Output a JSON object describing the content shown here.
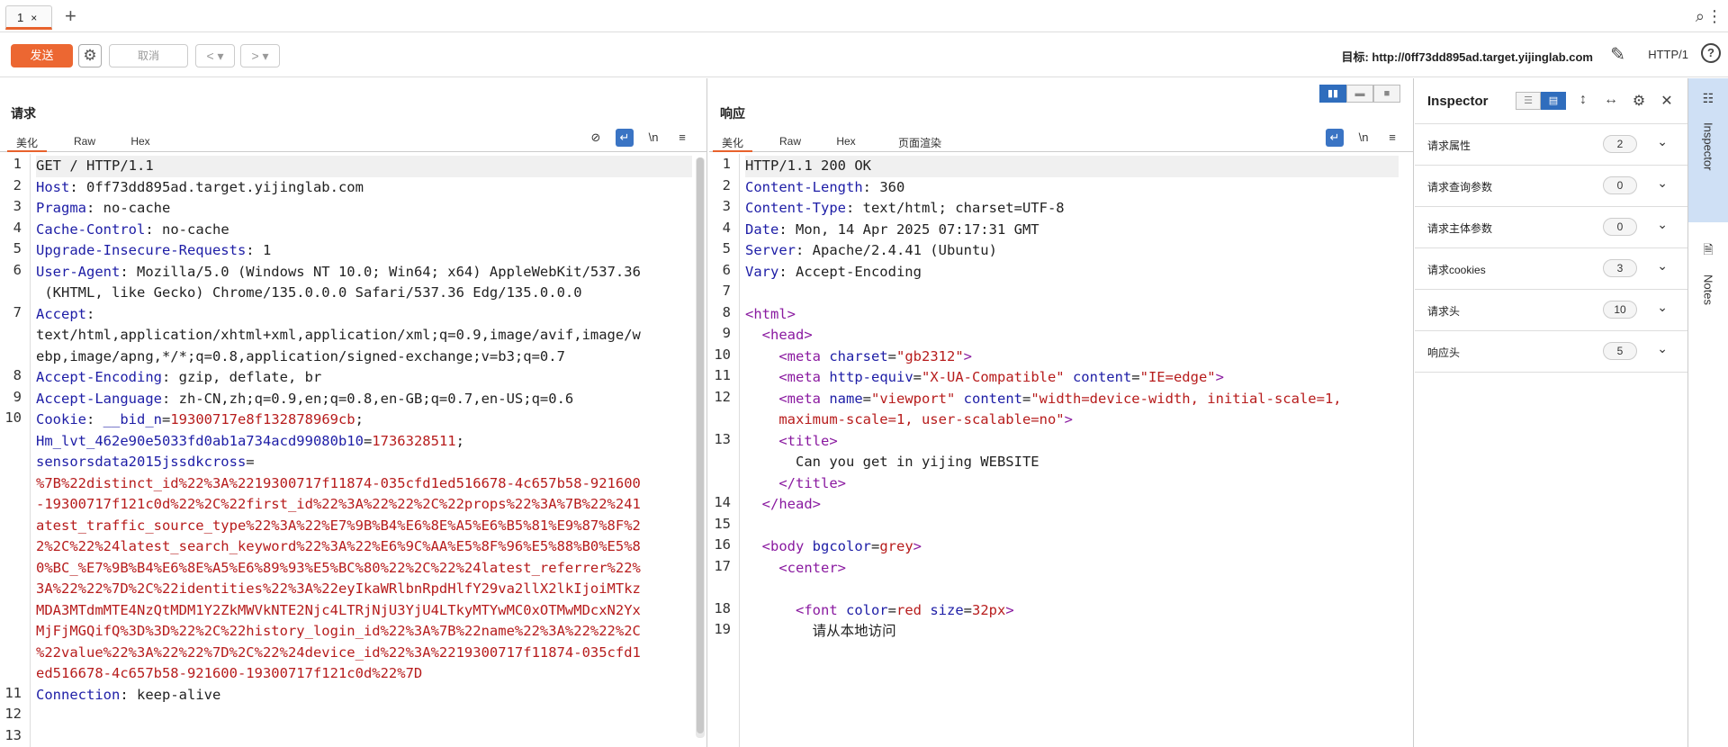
{
  "tabbar": {
    "tab_label": "1",
    "tab_close": "×",
    "add": "+"
  },
  "toolbar": {
    "send": "发送",
    "cancel": "取消",
    "back": "< ▾",
    "forward": "> ▾",
    "target": "目标: http://0ff73dd895ad.target.yijinglab.com",
    "protocol": "HTTP/1",
    "help": "?"
  },
  "request": {
    "title": "请求",
    "tabs": [
      "美化",
      "Raw",
      "Hex"
    ],
    "lines": [
      {
        "n": "1",
        "parts": [
          {
            "t": "GET / HTTP/1.1",
            "c": ""
          }
        ]
      },
      {
        "n": "2",
        "parts": [
          {
            "t": "Host",
            "c": "k"
          },
          {
            "t": ": 0ff73dd895ad.target.yijinglab.com",
            "c": ""
          }
        ]
      },
      {
        "n": "3",
        "parts": [
          {
            "t": "Pragma",
            "c": "k"
          },
          {
            "t": ": no-cache",
            "c": ""
          }
        ]
      },
      {
        "n": "4",
        "parts": [
          {
            "t": "Cache-Control",
            "c": "k"
          },
          {
            "t": ": no-cache",
            "c": ""
          }
        ]
      },
      {
        "n": "5",
        "parts": [
          {
            "t": "Upgrade-Insecure-Requests",
            "c": "k"
          },
          {
            "t": ": 1",
            "c": ""
          }
        ]
      },
      {
        "n": "6",
        "parts": [
          {
            "t": "User-Agent",
            "c": "k"
          },
          {
            "t": ": Mozilla/5.0 (Windows NT 10.0; Win64; x64) AppleWebKit/537.36",
            "c": ""
          }
        ]
      },
      {
        "n": "",
        "parts": [
          {
            "t": " (KHTML, like Gecko) Chrome/135.0.0.0 Safari/537.36 Edg/135.0.0.0",
            "c": ""
          }
        ]
      },
      {
        "n": "7",
        "parts": [
          {
            "t": "Accept",
            "c": "k"
          },
          {
            "t": ":",
            "c": ""
          }
        ]
      },
      {
        "n": "",
        "parts": [
          {
            "t": "text/html,application/xhtml+xml,application/xml;q=0.9,image/avif,image/w",
            "c": ""
          }
        ]
      },
      {
        "n": "",
        "parts": [
          {
            "t": "ebp,image/apng,*/*;q=0.8,application/signed-exchange;v=b3;q=0.7",
            "c": ""
          }
        ]
      },
      {
        "n": "8",
        "parts": [
          {
            "t": "Accept-Encoding",
            "c": "k"
          },
          {
            "t": ": gzip, deflate, br",
            "c": ""
          }
        ]
      },
      {
        "n": "9",
        "parts": [
          {
            "t": "Accept-Language",
            "c": "k"
          },
          {
            "t": ": zh-CN,zh;q=0.9,en;q=0.8,en-GB;q=0.7,en-US;q=0.6",
            "c": ""
          }
        ]
      },
      {
        "n": "10",
        "parts": [
          {
            "t": "Cookie",
            "c": "k"
          },
          {
            "t": ": ",
            "c": ""
          },
          {
            "t": "__bid_n",
            "c": "k"
          },
          {
            "t": "=",
            "c": ""
          },
          {
            "t": "19300717e8f132878969cb",
            "c": "v"
          },
          {
            "t": ";",
            "c": ""
          }
        ]
      },
      {
        "n": "",
        "parts": [
          {
            "t": "Hm_lvt_462e90e5033fd0ab1a734acd99080b10",
            "c": "k"
          },
          {
            "t": "=",
            "c": ""
          },
          {
            "t": "1736328511",
            "c": "v"
          },
          {
            "t": ";",
            "c": ""
          }
        ]
      },
      {
        "n": "",
        "parts": [
          {
            "t": "sensorsdata2015jssdkcross",
            "c": "k"
          },
          {
            "t": "=",
            "c": ""
          }
        ]
      },
      {
        "n": "",
        "parts": [
          {
            "t": "%7B%22distinct_id%22%3A%2219300717f11874-035cfd1ed516678-4c657b58-921600",
            "c": "v"
          }
        ]
      },
      {
        "n": "",
        "parts": [
          {
            "t": "-19300717f121c0d%22%2C%22first_id%22%3A%22%22%2C%22props%22%3A%7B%22%241",
            "c": "v"
          }
        ]
      },
      {
        "n": "",
        "parts": [
          {
            "t": "atest_traffic_source_type%22%3A%22%E7%9B%B4%E6%8E%A5%E6%B5%81%E9%87%8F%2",
            "c": "v"
          }
        ]
      },
      {
        "n": "",
        "parts": [
          {
            "t": "2%2C%22%24latest_search_keyword%22%3A%22%E6%9C%AA%E5%8F%96%E5%88%B0%E5%8",
            "c": "v"
          }
        ]
      },
      {
        "n": "",
        "parts": [
          {
            "t": "0%BC_%E7%9B%B4%E6%8E%A5%E6%89%93%E5%BC%80%22%2C%22%24latest_referrer%22%",
            "c": "v"
          }
        ]
      },
      {
        "n": "",
        "parts": [
          {
            "t": "3A%22%22%7D%2C%22identities%22%3A%22eyIkaWRlbnRpdHlfY29va2llX2lkIjoiMTkz",
            "c": "v"
          }
        ]
      },
      {
        "n": "",
        "parts": [
          {
            "t": "MDA3MTdmMTE4NzQtMDM1Y2ZkMWVkNTE2Njc4LTRjNjU3YjU4LTkyMTYwMC0xOTMwMDcxN2Yx",
            "c": "v"
          }
        ]
      },
      {
        "n": "",
        "parts": [
          {
            "t": "MjFjMGQifQ%3D%3D%22%2C%22history_login_id%22%3A%7B%22name%22%3A%22%22%2C",
            "c": "v"
          }
        ]
      },
      {
        "n": "",
        "parts": [
          {
            "t": "%22value%22%3A%22%22%7D%2C%22%24device_id%22%3A%2219300717f11874-035cfd1",
            "c": "v"
          }
        ]
      },
      {
        "n": "",
        "parts": [
          {
            "t": "ed516678-4c657b58-921600-19300717f121c0d%22%7D",
            "c": "v"
          }
        ]
      },
      {
        "n": "11",
        "parts": [
          {
            "t": "Connection",
            "c": "k"
          },
          {
            "t": ": keep-alive",
            "c": ""
          }
        ]
      },
      {
        "n": "12",
        "parts": [
          {
            "t": "",
            "c": ""
          }
        ]
      },
      {
        "n": "13",
        "parts": [
          {
            "t": "",
            "c": ""
          }
        ]
      }
    ]
  },
  "response": {
    "title": "响应",
    "tabs": [
      "美化",
      "Raw",
      "Hex",
      "页面渲染"
    ],
    "lines": [
      {
        "n": "1",
        "parts": [
          {
            "t": "HTTP/1.1 200 OK",
            "c": ""
          }
        ]
      },
      {
        "n": "2",
        "parts": [
          {
            "t": "Content-Length",
            "c": "k"
          },
          {
            "t": ": 360",
            "c": ""
          }
        ]
      },
      {
        "n": "3",
        "parts": [
          {
            "t": "Content-Type",
            "c": "k"
          },
          {
            "t": ": text/html; charset=UTF-8",
            "c": ""
          }
        ]
      },
      {
        "n": "4",
        "parts": [
          {
            "t": "Date",
            "c": "k"
          },
          {
            "t": ": Mon, 14 Apr 2025 07:17:31 GMT",
            "c": ""
          }
        ]
      },
      {
        "n": "5",
        "parts": [
          {
            "t": "Server",
            "c": "k"
          },
          {
            "t": ": Apache/2.4.41 (Ubuntu)",
            "c": ""
          }
        ]
      },
      {
        "n": "6",
        "parts": [
          {
            "t": "Vary",
            "c": "k"
          },
          {
            "t": ": Accept-Encoding",
            "c": ""
          }
        ]
      },
      {
        "n": "7",
        "parts": [
          {
            "t": "",
            "c": ""
          }
        ]
      },
      {
        "n": "8",
        "parts": [
          {
            "t": "<html>",
            "c": "tag"
          }
        ]
      },
      {
        "n": "9",
        "parts": [
          {
            "t": "  <head>",
            "c": "tag"
          }
        ]
      },
      {
        "n": "10",
        "parts": [
          {
            "t": "    <meta ",
            "c": "tag"
          },
          {
            "t": "charset",
            "c": "attr"
          },
          {
            "t": "=",
            "c": ""
          },
          {
            "t": "\"gb2312\"",
            "c": "v"
          },
          {
            "t": ">",
            "c": "tag"
          }
        ]
      },
      {
        "n": "11",
        "parts": [
          {
            "t": "    <meta ",
            "c": "tag"
          },
          {
            "t": "http-equiv",
            "c": "attr"
          },
          {
            "t": "=",
            "c": ""
          },
          {
            "t": "\"X-UA-Compatible\"",
            "c": "v"
          },
          {
            "t": " content",
            "c": "attr"
          },
          {
            "t": "=",
            "c": ""
          },
          {
            "t": "\"IE=edge\"",
            "c": "v"
          },
          {
            "t": ">",
            "c": "tag"
          }
        ]
      },
      {
        "n": "12",
        "parts": [
          {
            "t": "    <meta ",
            "c": "tag"
          },
          {
            "t": "name",
            "c": "attr"
          },
          {
            "t": "=",
            "c": ""
          },
          {
            "t": "\"viewport\"",
            "c": "v"
          },
          {
            "t": " content",
            "c": "attr"
          },
          {
            "t": "=",
            "c": ""
          },
          {
            "t": "\"width=device-width, initial-scale=1,",
            "c": "v"
          }
        ]
      },
      {
        "n": "",
        "parts": [
          {
            "t": "    maximum-scale=1, user-scalable=no\"",
            "c": "v"
          },
          {
            "t": ">",
            "c": "tag"
          }
        ]
      },
      {
        "n": "13",
        "parts": [
          {
            "t": "    <title>",
            "c": "tag"
          }
        ]
      },
      {
        "n": "",
        "parts": [
          {
            "t": "      Can you get in yijing WEBSITE",
            "c": ""
          }
        ]
      },
      {
        "n": "",
        "parts": [
          {
            "t": "    </title>",
            "c": "tag"
          }
        ]
      },
      {
        "n": "14",
        "parts": [
          {
            "t": "  </head>",
            "c": "tag"
          }
        ]
      },
      {
        "n": "15",
        "parts": [
          {
            "t": "",
            "c": ""
          }
        ]
      },
      {
        "n": "16",
        "parts": [
          {
            "t": "  <body ",
            "c": "tag"
          },
          {
            "t": "bgcolor",
            "c": "attr"
          },
          {
            "t": "=",
            "c": ""
          },
          {
            "t": "grey",
            "c": "v"
          },
          {
            "t": ">",
            "c": "tag"
          }
        ]
      },
      {
        "n": "17",
        "parts": [
          {
            "t": "    <center>",
            "c": "tag"
          }
        ]
      },
      {
        "n": "",
        "parts": [
          {
            "t": "",
            "c": ""
          }
        ]
      },
      {
        "n": "18",
        "parts": [
          {
            "t": "      <font ",
            "c": "tag"
          },
          {
            "t": "color",
            "c": "attr"
          },
          {
            "t": "=",
            "c": ""
          },
          {
            "t": "red",
            "c": "v"
          },
          {
            "t": " size",
            "c": "attr"
          },
          {
            "t": "=",
            "c": ""
          },
          {
            "t": "32px",
            "c": "v"
          },
          {
            "t": ">",
            "c": "tag"
          }
        ]
      },
      {
        "n": "19",
        "parts": [
          {
            "t": "        请从本地访问",
            "c": ""
          }
        ]
      }
    ]
  },
  "inspector": {
    "title": "Inspector",
    "sections": [
      {
        "label": "请求属性",
        "count": "2"
      },
      {
        "label": "请求查询参数",
        "count": "0"
      },
      {
        "label": "请求主体参数",
        "count": "0"
      },
      {
        "label": "请求cookies",
        "count": "3"
      },
      {
        "label": "请求头",
        "count": "10"
      },
      {
        "label": "响应头",
        "count": "5"
      }
    ]
  },
  "side_rail": {
    "inspector": "Inspector",
    "notes": "Notes"
  },
  "colors": {
    "accent": "#ec6732",
    "key": "#1d1da6",
    "value": "#b71c1c",
    "tag": "#8a1aa0",
    "selected": "#2f6dbd"
  }
}
